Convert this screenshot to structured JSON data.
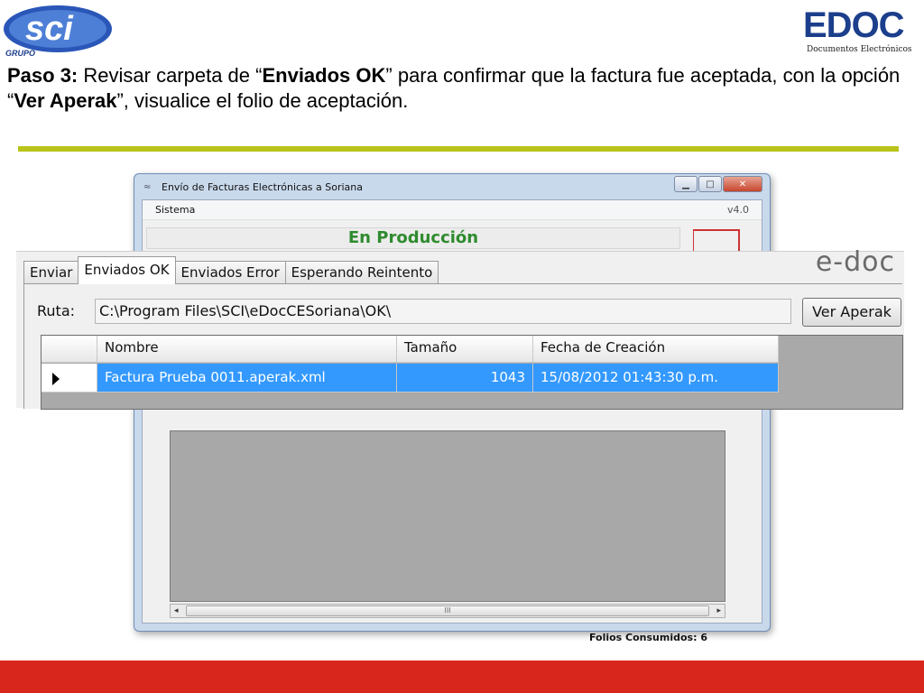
{
  "header": {
    "sci_logo_text": "sci",
    "sci_logo_sub": "GRUPO",
    "edoc_logo_text": "EDOC",
    "edoc_logo_sub": "Documentos Electrónicos"
  },
  "instruction": {
    "step": "Paso 3:",
    "part1": " Revisar carpeta de “",
    "folder": "Enviados OK",
    "part2": "” para confirmar que la factura fue aceptada, con la opción “",
    "option": "Ver Aperak",
    "part3": "”, visualice el folio de aceptación."
  },
  "colors": {
    "divider": "#b8c41a",
    "footer": "#d9261c",
    "production": "#2e8b2e",
    "selection": "#3399ff"
  },
  "window": {
    "title": "Envío de Facturas Electrónicas a Soriana",
    "menu_sistema": "Sistema",
    "version": "v4.0",
    "production_banner": "En Producción",
    "status": "Folios Consumidos: 6",
    "scroll_grip": "III",
    "scroll_left": "◂",
    "scroll_right": "▸",
    "minimize": "▁",
    "maximize": "□",
    "close": "✕"
  },
  "inset": {
    "logo": "e-doc",
    "tabs": [
      {
        "label": "Enviar"
      },
      {
        "label": "Enviados OK"
      },
      {
        "label": "Enviados Error"
      },
      {
        "label": "Esperando Reintento"
      }
    ],
    "active_tab": "Enviados OK",
    "ruta_label": "Ruta:",
    "ruta_value": "C:\\Program Files\\SCI\\eDocCESoriana\\OK\\",
    "ver_aperak_label": "Ver Aperak",
    "grid": {
      "columns": [
        "Nombre",
        "Tamaño",
        "Fecha de Creación"
      ],
      "rows": [
        {
          "nombre": "Factura Prueba 0011.aperak.xml",
          "tamano": "1043",
          "fecha": "15/08/2012 01:43:30 p.m."
        }
      ]
    }
  }
}
